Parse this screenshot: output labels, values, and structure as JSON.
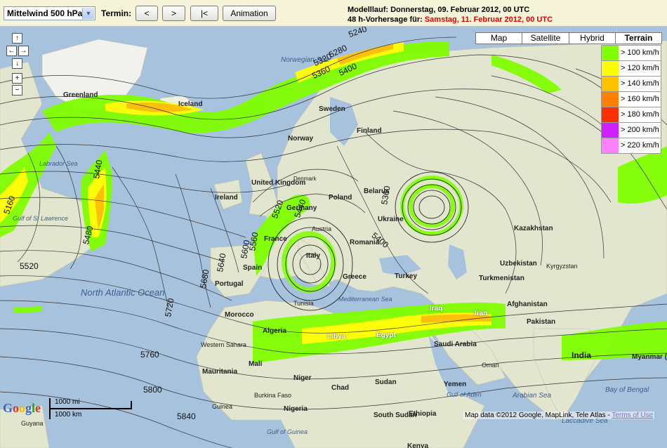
{
  "toolbar": {
    "level_select": "Mittelwind 500 hPa",
    "termin_label": "Termin:",
    "btn_prev": "<",
    "btn_next": ">",
    "btn_first": "|<",
    "btn_animation": "Animation",
    "model_run_label": "Modelllauf: Donnerstag, 09. Februar 2012, 00 UTC",
    "forecast_prefix": "48 h-Vorhersage für:",
    "forecast_value": "Samstag, 11. Februar 2012, 00 UTC"
  },
  "map_types": [
    "Map",
    "Satellite",
    "Hybrid",
    "Terrain"
  ],
  "active_map_type": "Terrain",
  "legend": [
    {
      "label": "> 100 km/h",
      "color": "#80ff00"
    },
    {
      "label": "> 120 km/h",
      "color": "#ffff00"
    },
    {
      "label": "> 140 km/h",
      "color": "#ffc000"
    },
    {
      "label": "> 160 km/h",
      "color": "#ff8000"
    },
    {
      "label": "> 180 km/h",
      "color": "#ff3000"
    },
    {
      "label": "> 200 km/h",
      "color": "#d020ff"
    },
    {
      "label": "> 220 km/h",
      "color": "#ff80ff"
    }
  ],
  "nav": {
    "up": "↑",
    "left": "←",
    "right": "→",
    "down": "↓",
    "zoom_in": "+",
    "zoom_out": "−"
  },
  "scale": {
    "miles": "1000 mi",
    "km": "1000 km"
  },
  "logo": "Google",
  "copyright": {
    "text": "Map data ©2012 Google, MapLink, Tele Atlas -",
    "link": "Terms of Use"
  },
  "place_labels": {
    "greenland": "Greenland",
    "iceland": "Iceland",
    "norwegian_sea": "Norwegian Sea",
    "sweden": "Sweden",
    "finland": "Finland",
    "norway": "Norway",
    "denmark": "Denmark",
    "united_kingdom": "United Kingdom",
    "ireland": "Ireland",
    "poland": "Poland",
    "belarus": "Belarus",
    "germany": "Germany",
    "ukraine": "Ukraine",
    "france": "France",
    "austria": "Austria",
    "romania": "Romania",
    "italy": "Italy",
    "spain": "Spain",
    "portugal": "Portugal",
    "greece": "Greece",
    "turkey": "Turkey",
    "kazakhstan": "Kazakhstan",
    "uzbekistan": "Uzbekistan",
    "kyrgyzstan": "Kyrgyzstan",
    "turkmenistan": "Turkmenistan",
    "afghanistan": "Afghanistan",
    "pakistan": "Pakistan",
    "india": "India",
    "morocco": "Morocco",
    "tunisia": "Tunisia",
    "algeria": "Algeria",
    "libya": "Libya",
    "egypt": "Egypt",
    "iraq": "Iraq",
    "iran": "Iran",
    "mediterranean": "Mediterranean Sea",
    "western_sahara": "Western Sahara",
    "mauritania": "Mauritania",
    "mali": "Mali",
    "niger": "Niger",
    "chad": "Chad",
    "sudan": "Sudan",
    "saudi_arabia": "Saudi Arabia",
    "oman": "Oman",
    "yemen": "Yemen",
    "gulf_of_aden": "Gulf of Aden",
    "arabian_sea": "Arabian Sea",
    "bay_of_bengal": "Bay of Bengal",
    "myanmar": "Myanmar (Burma)",
    "laccadive_sea": "Laccadive Sea",
    "burkina_faso": "Burkina Faso",
    "guinea": "Guinea",
    "nigeria": "Nigeria",
    "ethiopia": "Ethiopia",
    "south_sudan": "South Sudan",
    "kenya": "Kenya",
    "guyana": "Guyana",
    "gulf_of_guinea": "Gulf of Guinea",
    "north_atlantic_ocean": "North Atlantic Ocean",
    "labrador_sea": "Labrador Sea",
    "gulf_st_lawrence": "Gulf of St Lawrence"
  },
  "contour_labels": [
    "5240",
    "5280",
    "5320",
    "5360",
    "5400",
    "5440",
    "5480",
    "5520",
    "5160",
    "5360",
    "5400",
    "5440",
    "5520",
    "5560",
    "5600",
    "5640",
    "5680",
    "5720",
    "5760",
    "5800",
    "5840",
    "5300",
    "5400"
  ]
}
